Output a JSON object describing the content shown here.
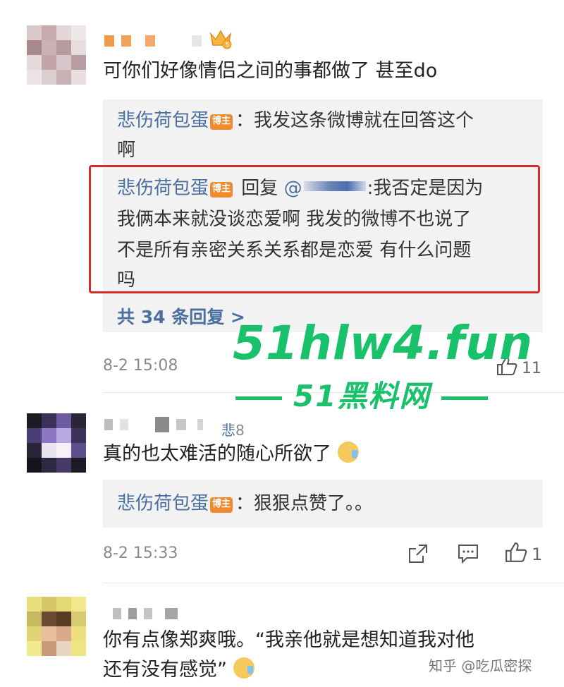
{
  "comments": [
    {
      "text": "可你们好像情侣之间的事都做了 甚至do",
      "replies": [
        {
          "name": "悲伤荷包蛋",
          "badge": "博主",
          "sep": "：",
          "text_l1": "我发这条微博就在回答这个",
          "text_l2": "啊"
        },
        {
          "name": "悲伤荷包蛋",
          "badge": "博主",
          "reply_prefix": "回复",
          "at": "@",
          "sep": ":",
          "text_l1": "我否定是因为",
          "text_l2": "我俩本来就没谈恋爱啊 我发的微博不也说了",
          "text_l3": "不是所有亲密关系关系都是恋爱 有什么问题",
          "text_l4": "吗"
        }
      ],
      "more_replies": "共 34 条回复 >",
      "timestamp": "8-2 15:08",
      "likes": "11"
    },
    {
      "name_partial": "悲",
      "name_partial_suffix": "8",
      "text": "真的也太难活的随心所欲了",
      "replies": [
        {
          "name": "悲伤荷包蛋",
          "badge": "博主",
          "sep": "：",
          "text_l1": "狠狠点赞了。。"
        }
      ],
      "timestamp": "8-2 15:33",
      "likes": "1"
    },
    {
      "text_l1": "你有点像郑爽哦。“我亲他就是想知道我对他",
      "text_l2": "还有没有感觉”"
    }
  ],
  "watermark": {
    "main": "51hlw4.fun",
    "sub": "51黑料网"
  },
  "source": "知乎 @吃瓜密探",
  "icons": {
    "crown": "crown-icon",
    "share": "share-icon",
    "comment": "comment-icon",
    "like": "thumbs-up-icon"
  },
  "colors": {
    "link_blue": "#4a6fa0",
    "highlight_red": "#d42b2b",
    "badge_orange": "#f08a2e",
    "watermark_green": "#19c26a"
  }
}
